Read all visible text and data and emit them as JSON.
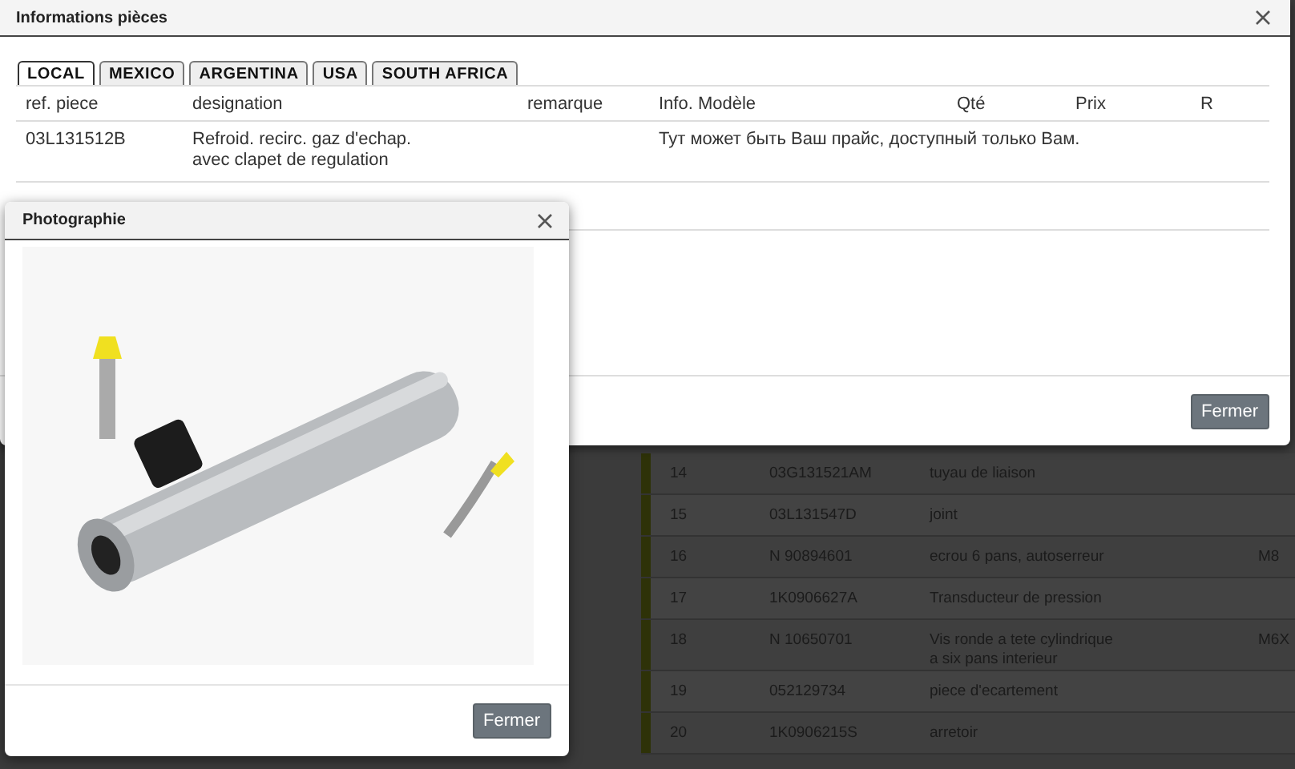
{
  "background_table": {
    "rows": [
      {
        "number": "14",
        "ref": "03G131521AM",
        "designation": [
          "tuyau de liaison"
        ]
      },
      {
        "number": "15",
        "ref": "03L131547D",
        "designation": [
          "joint"
        ]
      },
      {
        "number": "16",
        "ref": "N  90894601",
        "designation": [
          "ecrou 6 pans, autoserreur"
        ],
        "note": "M8"
      },
      {
        "number": "17",
        "ref": "1K0906627A",
        "designation": [
          "Transducteur de pression"
        ]
      },
      {
        "number": "18",
        "ref": "N  10650701",
        "designation": [
          "Vis ronde a tete cylindrique",
          "a six pans interieur"
        ],
        "note": "M6X"
      },
      {
        "number": "19",
        "ref": "052129734",
        "designation": [
          "piece d'ecartement"
        ]
      },
      {
        "number": "20",
        "ref": "1K0906215S",
        "designation": [
          "arretoir"
        ]
      }
    ]
  },
  "main_dialog": {
    "title": "Informations pièces",
    "tabs": [
      {
        "label": "LOCAL",
        "selected": true
      },
      {
        "label": "MEXICO",
        "selected": false
      },
      {
        "label": "ARGENTINA",
        "selected": false
      },
      {
        "label": "USA",
        "selected": false
      },
      {
        "label": "SOUTH AFRICA",
        "selected": false
      }
    ],
    "table": {
      "columns": [
        "ref. piece",
        "designation",
        "remarque",
        "Info. Modèle",
        "Qté",
        "Prix",
        "R"
      ],
      "rows": [
        {
          "ref": "03L131512B",
          "designation": [
            "Refroid. recirc. gaz d'echap.",
            "avec clapet de regulation"
          ],
          "info": "Тут может быть Ваш прайс, доступный только Вам."
        }
      ]
    },
    "close_button": "Fermer"
  },
  "photo_dialog": {
    "title": "Photographie",
    "close_button": "Fermer"
  }
}
